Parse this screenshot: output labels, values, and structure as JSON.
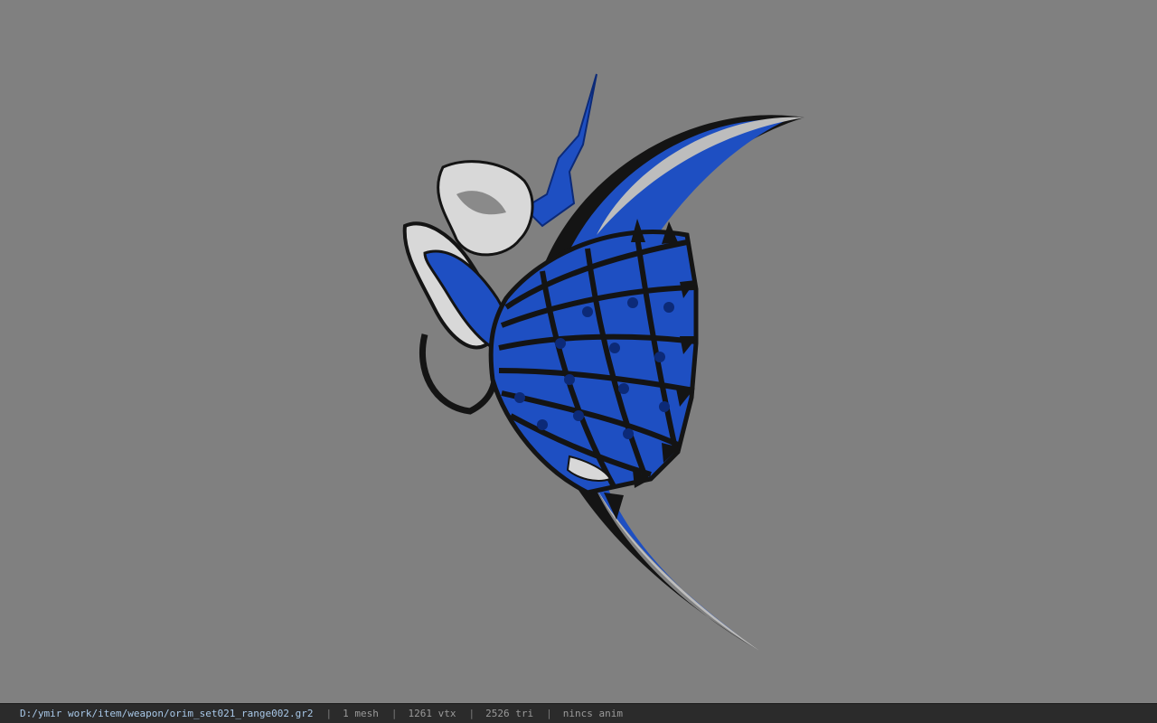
{
  "viewport": {
    "background_color": "#808080",
    "model_name": "orim_set021_range002",
    "colors": {
      "blue": "#1e4fc2",
      "dark_blue": "#0c2a78",
      "black": "#141414",
      "metal": "#d8d8d8",
      "metal_shade": "#8a8a8a"
    }
  },
  "status_bar": {
    "file_path": "D:/ymir work/item/weapon/orim_set021_range002.gr2",
    "separator": "|",
    "mesh_count": "1 mesh",
    "vertex_count": "1261 vtx",
    "triangle_count": "2526 tri",
    "animation_status": "nincs anim"
  }
}
